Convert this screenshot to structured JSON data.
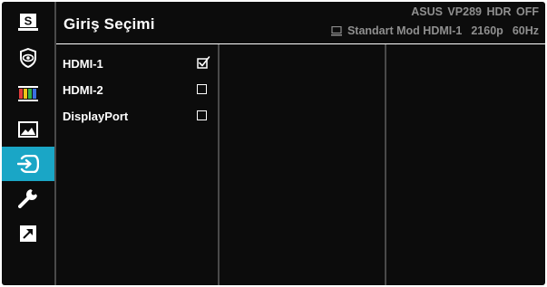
{
  "header": {
    "title": "Giriş Seçimi",
    "model": "ASUS  VP289 HDR OFF",
    "mode": "Standart Mod",
    "input": "HDMI-1",
    "resolution": "2160p",
    "refresh": "60Hz"
  },
  "sidebar": {
    "items": [
      {
        "icon": "splendid-s-icon",
        "active": false
      },
      {
        "icon": "eye-care-icon",
        "active": false
      },
      {
        "icon": "color-bars-icon",
        "active": false
      },
      {
        "icon": "image-icon",
        "active": false
      },
      {
        "icon": "input-select-icon",
        "active": true
      },
      {
        "icon": "wrench-icon",
        "active": false
      },
      {
        "icon": "shortcut-arrow-icon",
        "active": false
      }
    ]
  },
  "options": [
    {
      "label": "HDMI-1",
      "checked": true
    },
    {
      "label": "HDMI-2",
      "checked": false
    },
    {
      "label": "DisplayPort",
      "checked": false
    }
  ],
  "colors": {
    "background": "#0c0c0c",
    "accent": "#1aa6c6",
    "text": "#ffffff",
    "muted": "#8f8f8f"
  }
}
